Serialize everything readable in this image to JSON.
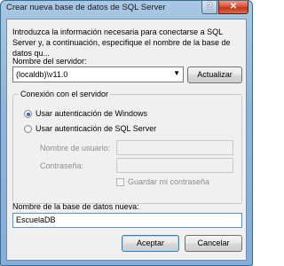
{
  "window": {
    "title": "Crear nueva base de datos de SQL Server",
    "help_glyph": "?",
    "close_glyph": "✕"
  },
  "intro_text": "Introduzca la información necesaria para conectarse a SQL Server y, a continuación, especifique el nombre de la base de datos qu...",
  "server": {
    "label": "Nombre del servidor:",
    "value": "(localdb)\\v11.0",
    "refresh_button": "Actualizar"
  },
  "connection": {
    "group_title": "Conexión con el servidor",
    "windows_auth_label": "Usar autenticación de Windows",
    "sql_auth_label": "Usar autenticación de SQL Server",
    "selected": "windows",
    "username_label": "Nombre de usuario:",
    "password_label": "Contraseña:",
    "save_password_label": "Guardar mi contraseña"
  },
  "database": {
    "label": "Nombre de la base de datos nueva:",
    "value": "EscuelaDB"
  },
  "buttons": {
    "ok": "Aceptar",
    "cancel": "Cancelar"
  },
  "colors": {
    "title_bar": "#8fb5d8",
    "close_button": "#c43417",
    "dialog_background": "#f0f0f0",
    "default_button_border": "#3c7fb1"
  }
}
